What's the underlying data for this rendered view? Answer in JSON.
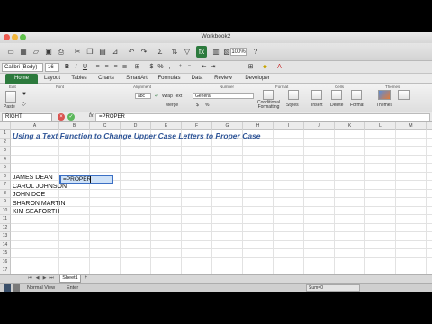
{
  "window": {
    "title": "Workbook2",
    "zoom": "100%"
  },
  "format_bar": {
    "font_name": "Calibri (Body)",
    "font_size": "16",
    "bold": "B",
    "italic": "I",
    "underline": "U"
  },
  "ribbon_tabs": [
    "Home",
    "Layout",
    "Tables",
    "Charts",
    "SmartArt",
    "Formulas",
    "Data",
    "Review",
    "Developer"
  ],
  "ribbon": {
    "groups": {
      "edit": "Edit",
      "font": "Font",
      "alignment": "Alignment",
      "number": "Number",
      "format": "Format",
      "cells": "Cells",
      "themes": "Themes"
    },
    "wrap_text": "Wrap Text",
    "number_format": "General",
    "align_preview": "abc",
    "buttons": {
      "paste": "Paste",
      "merge": "Merge",
      "conditional": "Conditional\nFormatting",
      "styles": "Styles",
      "insert": "Insert",
      "delete": "Delete",
      "format": "Format",
      "themes": "Themes"
    }
  },
  "formula_bar": {
    "name_box": "RIGHT",
    "fx": "fx",
    "formula": "=PROPER"
  },
  "columns": [
    "A",
    "B",
    "C",
    "D",
    "E",
    "F",
    "G",
    "H",
    "I",
    "J",
    "K",
    "L",
    "M",
    "N"
  ],
  "rows": [
    "1",
    "2",
    "3",
    "4",
    "5",
    "6",
    "7",
    "8",
    "9",
    "10",
    "11",
    "12",
    "13",
    "14",
    "15",
    "16",
    "17"
  ],
  "sheet": {
    "heading": "Using a Text Function to Change Upper Case Letters to Proper Case",
    "names": [
      "JAMES DEAN",
      "CAROL JOHNSON",
      "JOHN DOE",
      "SHARON MARTIN",
      "KIM SEAFORTH"
    ],
    "editing_cell_value": "=PROPER"
  },
  "sheet_tabs": [
    "Sheet1"
  ],
  "status_bar": {
    "view": "Normal View",
    "mode": "Enter",
    "sum": "Sum=0"
  },
  "colors": {
    "accent_green": "#2c7a3d",
    "heading_blue": "#2f5597",
    "selection_blue": "#3b6fc4"
  }
}
